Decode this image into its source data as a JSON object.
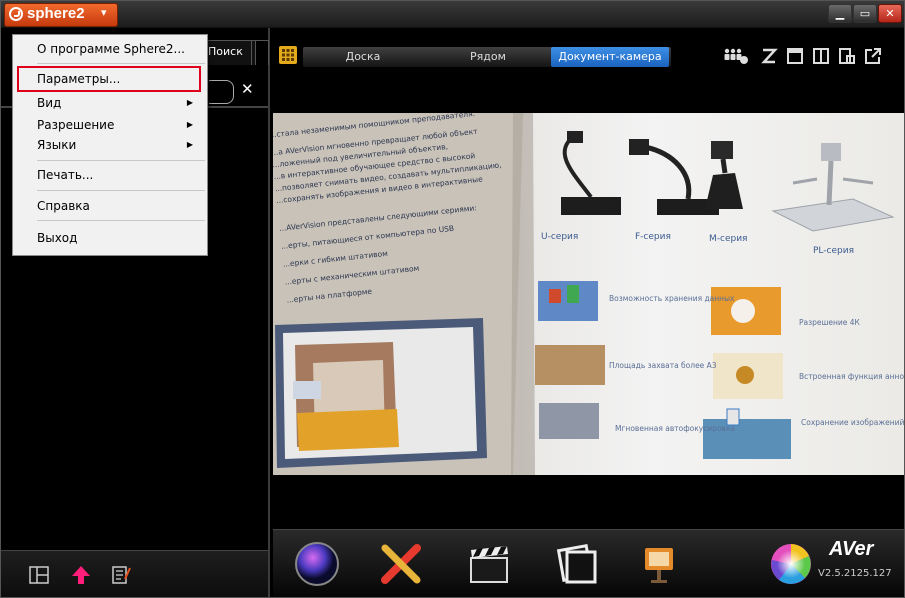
{
  "app": {
    "name": "sphere2",
    "caret": "▾"
  },
  "window": {
    "minimize": "▁",
    "restore": "▭",
    "close": "✕"
  },
  "left": {
    "search_tab": "Поиск",
    "clear": "✕"
  },
  "menu": {
    "items": [
      {
        "label": "О программе Sphere2..."
      },
      {
        "label": "Параметры..."
      },
      {
        "label": "Вид",
        "submenu": true
      },
      {
        "label": "Разрешение",
        "submenu": true
      },
      {
        "label": "Языки",
        "submenu": true
      },
      {
        "label": "Печать..."
      },
      {
        "label": "Справка"
      },
      {
        "label": "Выход"
      }
    ]
  },
  "tabs": [
    {
      "label": "Доска",
      "active": false
    },
    {
      "label": "Рядом",
      "active": false
    },
    {
      "label": "Документ-камера",
      "active": true
    }
  ],
  "document": {
    "text_lines": [
      "...стала незаменимым помощником преподавателя.",
      "...а AVerVision мгновенно превращает любой объект",
      "...ложенный под увеличительный объектив,",
      "...в интерактивное обучающее средство с высокой",
      "...позволяет снимать видео, создавать мультипликацию,",
      "...сохранять изображения и видео в интерактивные",
      "...AVerVision представлены следующими сериями:",
      "...ерты, питающиеся от компьютера по USB",
      "...ерки с гибким штативом",
      "...ерты с механическим штативом",
      "...ерты на платформе"
    ],
    "series": [
      "U-серия",
      "F-серия",
      "M-серия",
      "PL-серия"
    ],
    "features": [
      "Возможность хранения данных",
      "Разрешение 4К",
      "Площадь захвата более А3",
      "Встроенная функция аннотаций",
      "Мгновенная автофокусировка",
      "Сохранение изображений и видео на USB или карту памяти SDHC"
    ]
  },
  "brand": {
    "logo": "AVer",
    "version": "V2.5.2125.127"
  },
  "colors": {
    "accent_orange": "#e5501c",
    "highlight_red": "#e1001b",
    "tab_active": "#2a78d4"
  }
}
